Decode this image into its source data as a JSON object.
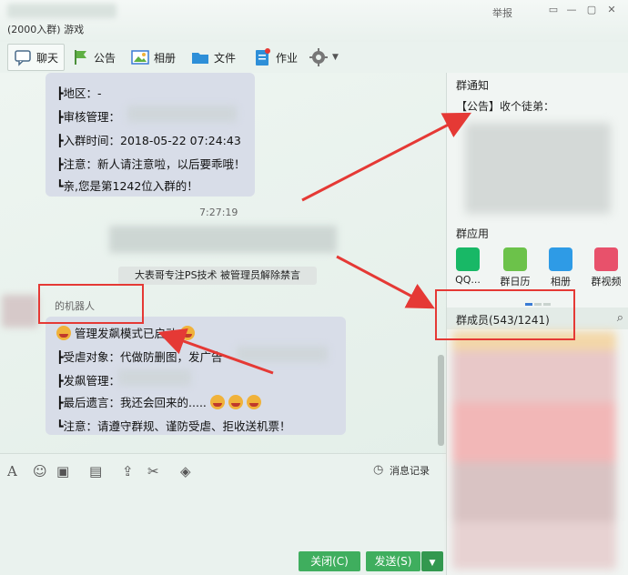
{
  "window": {
    "title": "(2000入群) 游戏",
    "report_label": "举报",
    "controls": [
      "▭",
      "—",
      "▢",
      "✕"
    ]
  },
  "tabs": [
    {
      "label": "聊天",
      "icon": "chat-icon"
    },
    {
      "label": "公告",
      "icon": "announcement-icon"
    },
    {
      "label": "相册",
      "icon": "album-icon"
    },
    {
      "label": "文件",
      "icon": "folder-icon"
    },
    {
      "label": "作业",
      "icon": "homework-icon"
    }
  ],
  "chat": {
    "message1": {
      "lines": [
        "┣地区：-",
        "┣审核管理：",
        "┣入群时间：2018-05-22 07:24:43",
        "┣注意：新人请注意啦，以后要乖哦！",
        "┗亲,您是第1242位入群的！"
      ]
    },
    "timestamp": "7:27:19",
    "system_message": "大表哥专注PS技术 被管理员解除禁言",
    "sender_name": "的机器人",
    "message2": {
      "heading": "管理发飙模式已启动",
      "lines": [
        "┣受虐对象：代做防删图，发广告",
        "┣发飙管理：",
        "┣最后遗言：我还会回来的.....",
        "┗注意：请遵守群规、谨防受虐、拒收送机票！"
      ]
    }
  },
  "input_toolbar": {
    "history_label": "消息记录"
  },
  "buttons": {
    "close_label": "关闭(C)",
    "send_label": "发送(S)"
  },
  "right_panel": {
    "notice_title": "群通知",
    "notice_text": "【公告】收个徒弟：",
    "apps_title": "群应用",
    "apps": [
      {
        "label": "QQ...",
        "color": "#18b866"
      },
      {
        "label": "群日历",
        "color": "#6cc24a"
      },
      {
        "label": "相册",
        "color": "#2e9be6"
      },
      {
        "label": "群视频",
        "color": "#e8516b"
      }
    ],
    "members_label": "群成员(543/1241)"
  },
  "colors": {
    "annotation": "#e53935",
    "send_button": "#3fae5e",
    "close_button": "#3fae5e"
  }
}
